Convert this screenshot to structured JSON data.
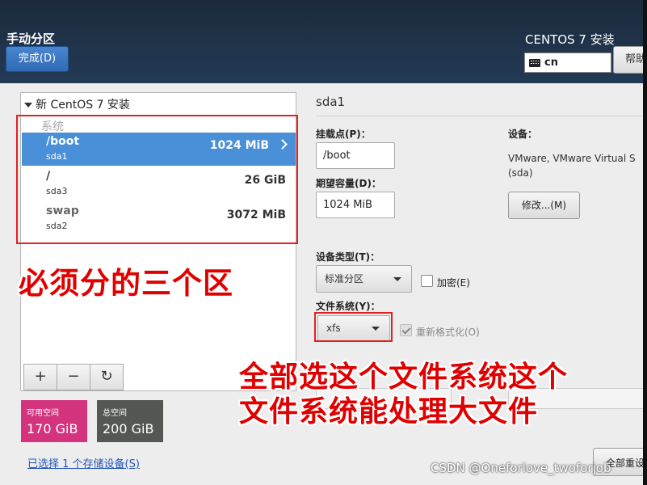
{
  "header": {
    "title": "手动分区",
    "done_label": "完成(D)",
    "product": "CENTOS 7 安装",
    "keyboard_layout": "cn",
    "help_label": "帮助"
  },
  "left_panel": {
    "install_header": "新 CentOS 7 安装",
    "group_label": "系统",
    "partitions": [
      {
        "mount": "/boot",
        "device": "sda1",
        "size": "1024 MiB",
        "selected": true
      },
      {
        "mount": "/",
        "device": "sda3",
        "size": "26 GiB",
        "selected": false
      },
      {
        "mount": "swap",
        "device": "sda2",
        "size": "3072 MiB",
        "selected": false
      }
    ],
    "toolbar": {
      "add": "+",
      "remove": "−",
      "refresh": "↻"
    }
  },
  "space": {
    "available_label": "可用空间",
    "available_value": "170 GiB",
    "total_label": "总空间",
    "total_value": "200 GiB"
  },
  "storage_link": "已选择 1 个存储设备(S)",
  "detail": {
    "title": "sda1",
    "mount_label": "挂载点(P)：",
    "mount_value": "/boot",
    "capacity_label": "期望容量(D)：",
    "capacity_value": "1024 MiB",
    "device_label": "设备：",
    "device_info_line1": "VMware, VMware Virtual S",
    "device_info_line2": "(sda)",
    "modify_label": "修改...(M)",
    "device_type_label": "设备类型(T)：",
    "device_type_value": "标准分区",
    "encrypt_label": "加密(E)",
    "filesystem_label": "文件系统(Y)：",
    "filesystem_value": "xfs",
    "reformat_label": "重新格式化(O)",
    "reset_label": "全部重设"
  },
  "annotations": {
    "note1": "必须分的三个区",
    "note2": "全部选这个文件系统这个",
    "note3": "文件系统能处理大文件"
  },
  "watermark": "CSDN @Oneforlove_twoforjob",
  "colors": {
    "header_bg": "#1b2a3c",
    "selected_row": "#4a90d9",
    "available_space": "#d3347d",
    "total_space": "#555753",
    "annotation_red": "#e00000"
  }
}
